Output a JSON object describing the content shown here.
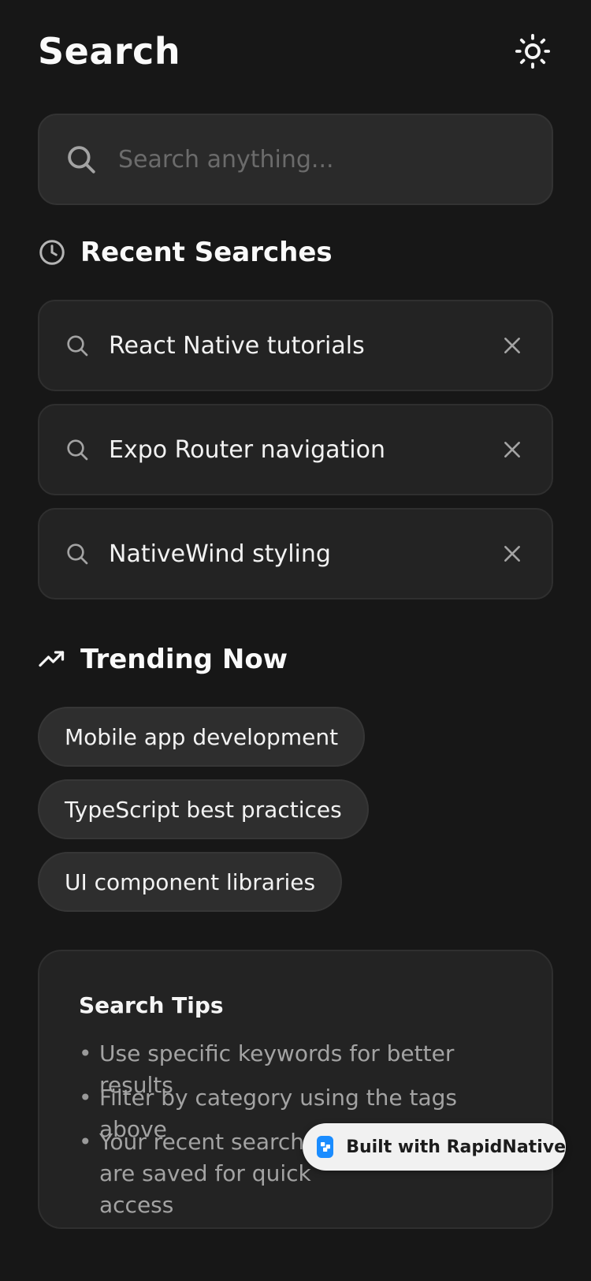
{
  "header": {
    "title": "Search",
    "theme_icon": "sun-icon"
  },
  "search": {
    "placeholder": "Search anything...",
    "value": ""
  },
  "recent": {
    "heading": "Recent Searches",
    "icon": "clock-icon",
    "items": [
      {
        "label": "React Native tutorials"
      },
      {
        "label": "Expo Router navigation"
      },
      {
        "label": "NativeWind styling"
      }
    ]
  },
  "trending": {
    "heading": "Trending Now",
    "icon": "trending-up-icon",
    "chips": [
      {
        "label": "Mobile app development"
      },
      {
        "label": "TypeScript best practices"
      },
      {
        "label": "UI component libraries"
      }
    ]
  },
  "tips": {
    "title": "Search Tips",
    "items": [
      {
        "bullet": "•",
        "text": "Use specific keywords for better results"
      },
      {
        "bullet": "•",
        "text": "Filter by category using the tags above"
      },
      {
        "bullet": "•",
        "text": "Your recent searches are saved for quick access"
      }
    ]
  },
  "badge": {
    "label": "Built with RapidNative"
  },
  "colors": {
    "background": "#171717",
    "surface": "#232323",
    "input": "#2a2a2a",
    "chip": "#2e2e2e",
    "text": "#f5f5f5",
    "muted": "#a3a3a3",
    "badge_bg": "#f1f1f1",
    "badge_logo": "#1a8cff"
  }
}
